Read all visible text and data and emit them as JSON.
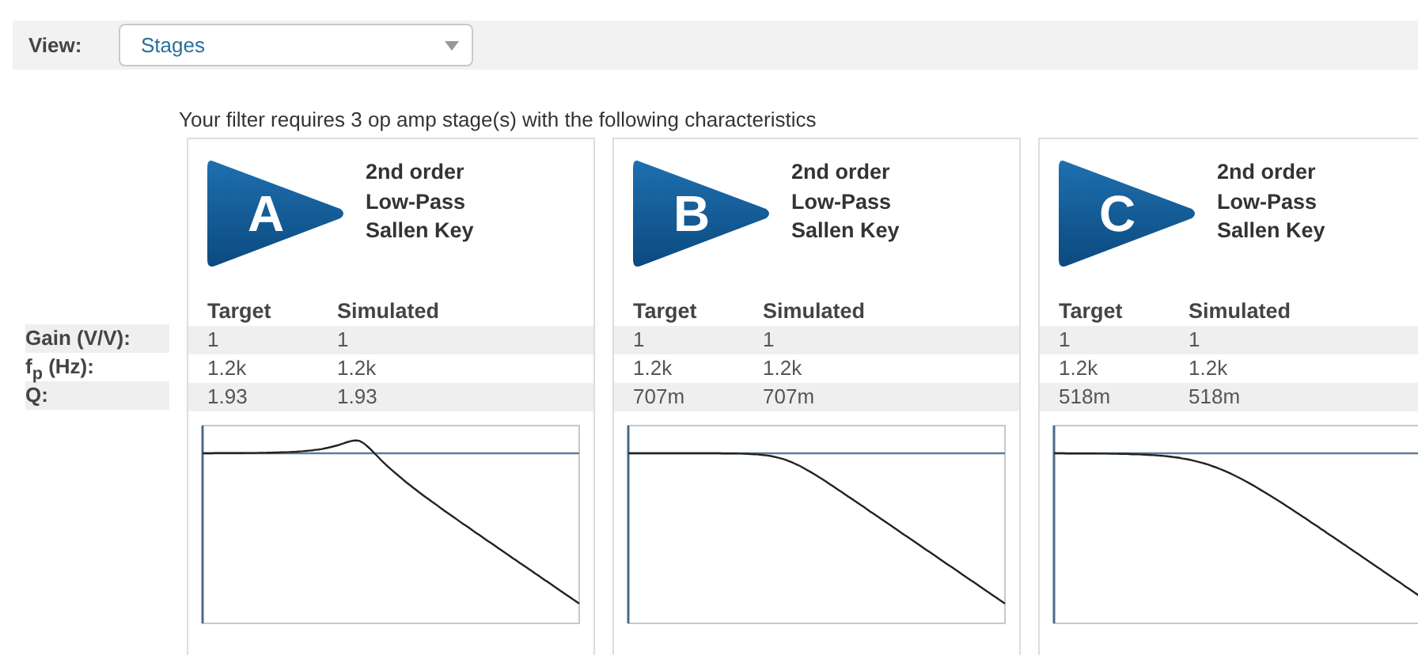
{
  "toolbar": {
    "label": "View:",
    "select": {
      "value": "Stages"
    }
  },
  "intro": "Your filter requires 3 op amp stage(s) with the following characteristics",
  "row_labels": [
    "Gain (V/V):",
    "f$_{p}$ (Hz):",
    "Q:"
  ],
  "stages": [
    {
      "letter": "A",
      "title": [
        "2nd order",
        "Low-Pass",
        "Sallen Key"
      ],
      "columns": [
        "Target",
        "Simulated"
      ],
      "rows": [
        [
          "1",
          "1"
        ],
        [
          "1.2k",
          "1.2k"
        ],
        [
          "1.93",
          "1.93"
        ]
      ]
    },
    {
      "letter": "B",
      "title": [
        "2nd order",
        "Low-Pass",
        "Sallen Key"
      ],
      "columns": [
        "Target",
        "Simulated"
      ],
      "rows": [
        [
          "1",
          "1"
        ],
        [
          "1.2k",
          "1.2k"
        ],
        [
          "707m",
          "707m"
        ]
      ]
    },
    {
      "letter": "C",
      "title": [
        "2nd order",
        "Low-Pass",
        "Sallen Key"
      ],
      "columns": [
        "Target",
        "Simulated"
      ],
      "rows": [
        [
          "1",
          "1"
        ],
        [
          "1.2k",
          "1.2k"
        ],
        [
          "518m",
          "518m"
        ]
      ]
    }
  ]
}
